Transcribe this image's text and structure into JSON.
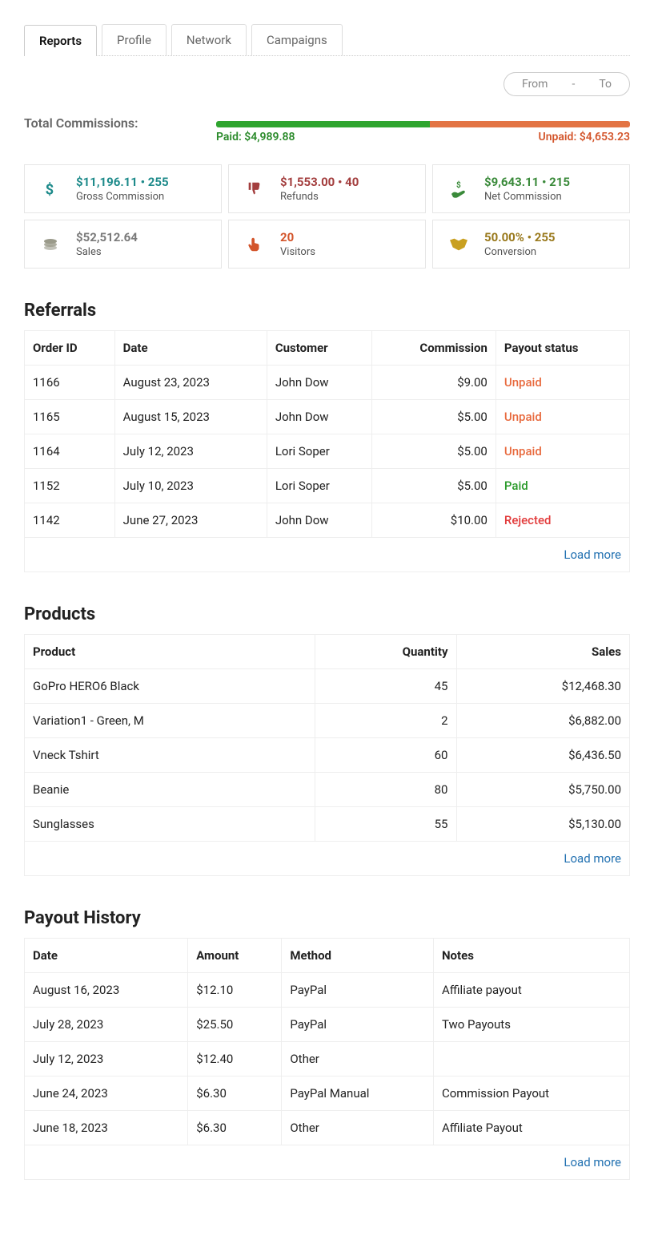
{
  "tabs": [
    "Reports",
    "Profile",
    "Network",
    "Campaigns"
  ],
  "active_tab": 0,
  "date_range": {
    "from": "From",
    "to": "To",
    "sep": "-"
  },
  "total_commissions": {
    "label": "Total Commissions:",
    "paid_label": "Paid: $4,989.88",
    "unpaid_label": "Unpaid: $4,653.23"
  },
  "stats": {
    "gross": {
      "value": "$11,196.11 • 255",
      "title": "Gross Commission"
    },
    "refunds": {
      "value": "$1,553.00 • 40",
      "title": "Refunds"
    },
    "net": {
      "value": "$9,643.11 • 215",
      "title": "Net Commission"
    },
    "sales": {
      "value": "$52,512.64",
      "title": "Sales"
    },
    "visitors": {
      "value": "20",
      "title": "Visitors"
    },
    "conversion": {
      "value": "50.00% • 255",
      "title": "Conversion"
    }
  },
  "referrals": {
    "heading": "Referrals",
    "columns": [
      "Order ID",
      "Date",
      "Customer",
      "Commission",
      "Payout status"
    ],
    "rows": [
      {
        "order": "1166",
        "date": "August 23, 2023",
        "customer": "John Dow",
        "commission": "$9.00",
        "status": "Unpaid",
        "status_class": "unpaid"
      },
      {
        "order": "1165",
        "date": "August 15, 2023",
        "customer": "John Dow",
        "commission": "$5.00",
        "status": "Unpaid",
        "status_class": "unpaid"
      },
      {
        "order": "1164",
        "date": "July 12, 2023",
        "customer": "Lori Soper",
        "commission": "$5.00",
        "status": "Unpaid",
        "status_class": "unpaid"
      },
      {
        "order": "1152",
        "date": "July 10, 2023",
        "customer": "Lori Soper",
        "commission": "$5.00",
        "status": "Paid",
        "status_class": "paid"
      },
      {
        "order": "1142",
        "date": "June 27, 2023",
        "customer": "John Dow",
        "commission": "$10.00",
        "status": "Rejected",
        "status_class": "rejected"
      }
    ],
    "load_more": "Load more"
  },
  "products": {
    "heading": "Products",
    "columns": [
      "Product",
      "Quantity",
      "Sales"
    ],
    "rows": [
      {
        "product": "GoPro HERO6 Black",
        "qty": "45",
        "sales": "$12,468.30"
      },
      {
        "product": "Variation1 - Green, M",
        "qty": "2",
        "sales": "$6,882.00"
      },
      {
        "product": "Vneck Tshirt",
        "qty": "60",
        "sales": "$6,436.50"
      },
      {
        "product": "Beanie",
        "qty": "80",
        "sales": "$5,750.00"
      },
      {
        "product": "Sunglasses",
        "qty": "55",
        "sales": "$5,130.00"
      }
    ],
    "load_more": "Load more"
  },
  "payout_history": {
    "heading": "Payout History",
    "columns": [
      "Date",
      "Amount",
      "Method",
      "Notes"
    ],
    "rows": [
      {
        "date": "August 16, 2023",
        "amount": "$12.10",
        "method": "PayPal",
        "notes": "Affiliate payout"
      },
      {
        "date": "July 28, 2023",
        "amount": "$25.50",
        "method": "PayPal",
        "notes": "Two Payouts"
      },
      {
        "date": "July 12, 2023",
        "amount": "$12.40",
        "method": "Other",
        "notes": ""
      },
      {
        "date": "June 24, 2023",
        "amount": "$6.30",
        "method": "PayPal Manual",
        "notes": "Commission Payout"
      },
      {
        "date": "June 18, 2023",
        "amount": "$6.30",
        "method": "Other",
        "notes": "Affiliate Payout"
      }
    ],
    "load_more": "Load more"
  }
}
